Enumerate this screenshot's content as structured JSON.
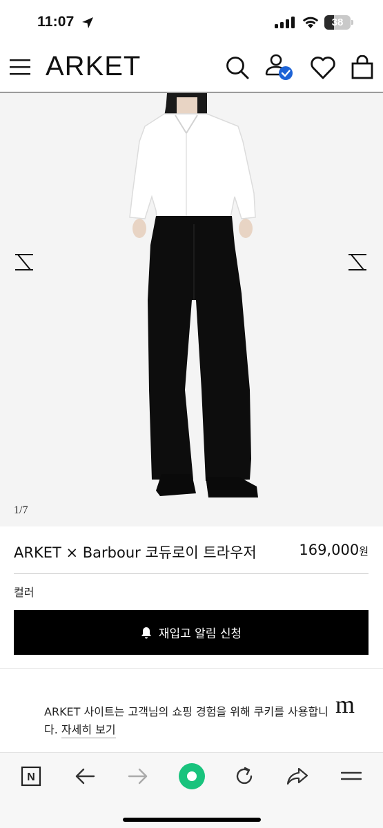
{
  "status_bar": {
    "time": "11:07",
    "battery_level": "38",
    "battery_fraction": 0.38
  },
  "header": {
    "brand": "ARKET",
    "icons": [
      "menu-icon",
      "search-icon",
      "account-icon",
      "wishlist-icon",
      "bag-icon"
    ]
  },
  "gallery": {
    "counter": "1/7",
    "prev_icon": "arrow-left-icon",
    "next_icon": "arrow-right-icon"
  },
  "product": {
    "name": "ARKET × Barbour 코듀로이 트라우저",
    "price_value": "169,000",
    "price_currency": "원",
    "color_label": "컬러",
    "restock_button_label": "재입고 알림 신청"
  },
  "cookie_notice": {
    "text": "ARKET 사이트는 고객님의 쇼핑 경험을 위해 쿠키를 사용합니다.",
    "link_label": "자세히 보기",
    "logo_glyph": "m"
  },
  "browser_toolbar": {
    "naver_label": "N",
    "items": [
      "naver-icon",
      "back-icon",
      "forward-icon",
      "home-icon",
      "reload-icon",
      "share-icon",
      "more-icon"
    ]
  },
  "colors": {
    "accent_badge": "#1d63d6",
    "home_button": "#19c37d",
    "button_black": "#000000"
  }
}
